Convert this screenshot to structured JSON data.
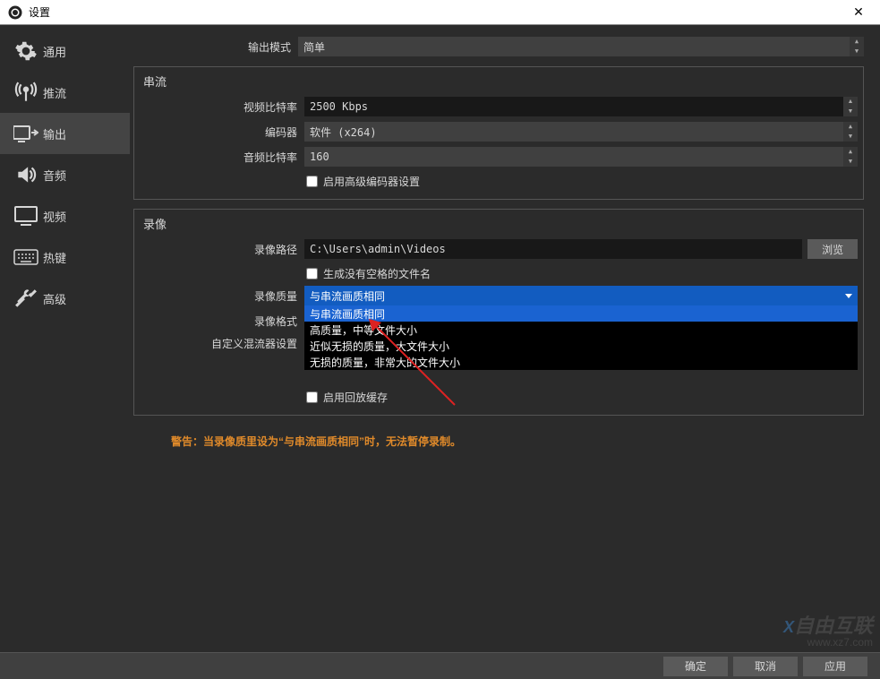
{
  "window": {
    "title": "设置"
  },
  "sidebar": {
    "items": [
      {
        "label": "通用"
      },
      {
        "label": "推流"
      },
      {
        "label": "输出"
      },
      {
        "label": "音频"
      },
      {
        "label": "视频"
      },
      {
        "label": "热键"
      },
      {
        "label": "高级"
      }
    ]
  },
  "content": {
    "output_mode_label": "输出模式",
    "output_mode_value": "简单",
    "streaming": {
      "legend": "串流",
      "video_bitrate_label": "视频比特率",
      "video_bitrate_value": "2500 Kbps",
      "encoder_label": "编码器",
      "encoder_value": "软件 (x264)",
      "audio_bitrate_label": "音频比特率",
      "audio_bitrate_value": "160",
      "adv_encoder_label": "启用高级编码器设置"
    },
    "recording": {
      "legend": "录像",
      "path_label": "录像路径",
      "path_value": "C:\\Users\\admin\\Videos",
      "browse_label": "浏览",
      "no_space_label": "生成没有空格的文件名",
      "quality_label": "录像质量",
      "quality_value": "与串流画质相同",
      "quality_options": [
        "与串流画质相同",
        "高质量，中等文件大小",
        "近似无损的质量，大文件大小",
        "无损的质量，非常大的文件大小"
      ],
      "format_label": "录像格式",
      "muxer_label": "自定义混流器设置",
      "replay_label": "启用回放缓存"
    },
    "warning_text": "警告：当录像质里设为“与串流画质相同”时，无法暂停录制。"
  },
  "footer": {
    "ok": "确定",
    "cancel": "取消",
    "apply": "应用"
  },
  "watermark": {
    "cn": "自由互联",
    "url": "www.xz7.com"
  }
}
